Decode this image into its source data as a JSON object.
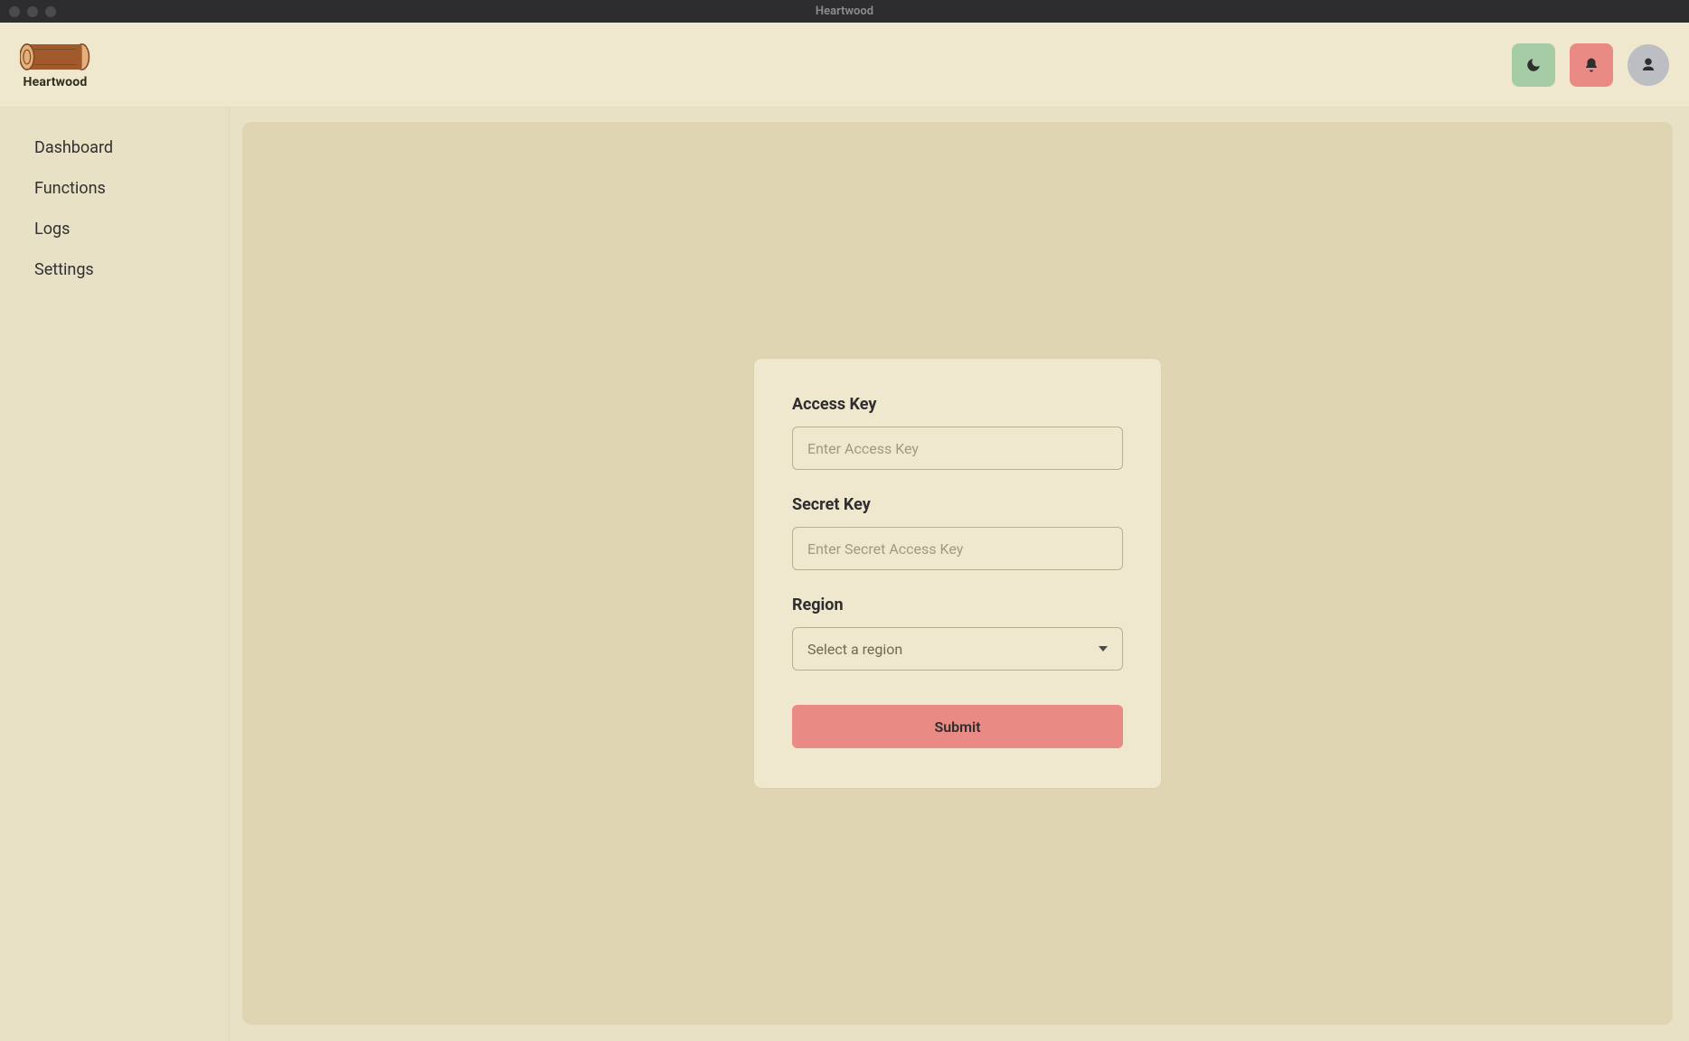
{
  "app": {
    "title": "Heartwood",
    "logo_text": "Heartwood"
  },
  "header": {
    "theme_icon": "moon-icon",
    "notif_icon": "bell-icon",
    "user_icon": "user-icon"
  },
  "sidebar": {
    "items": [
      {
        "label": "Dashboard"
      },
      {
        "label": "Functions"
      },
      {
        "label": "Logs"
      },
      {
        "label": "Settings"
      }
    ]
  },
  "form": {
    "access_key": {
      "label": "Access Key",
      "placeholder": "Enter Access Key",
      "value": ""
    },
    "secret_key": {
      "label": "Secret Key",
      "placeholder": "Enter Secret Access Key",
      "value": ""
    },
    "region": {
      "label": "Region",
      "placeholder": "Select a region",
      "selected": ""
    },
    "submit_label": "Submit"
  },
  "colors": {
    "bg": "#e9e1c5",
    "panel": "#e0d5b2",
    "card": "#efe8cf",
    "accent_green": "#a6cca6",
    "accent_red": "#e98a85",
    "accent_grey": "#bdbec3"
  }
}
